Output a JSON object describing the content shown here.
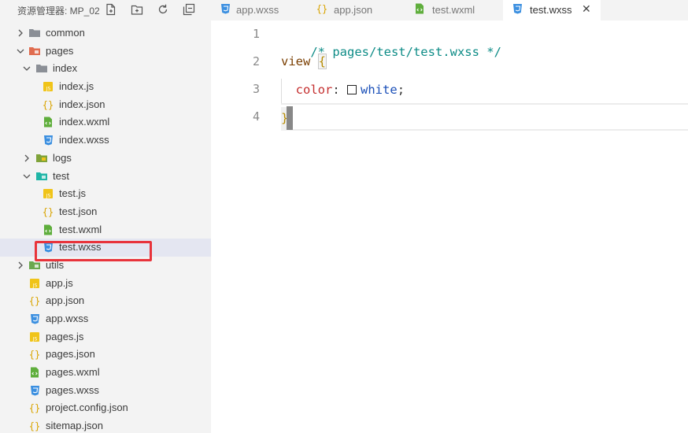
{
  "sidebar": {
    "title": "资源管理器: MP_02",
    "actions": [
      {
        "name": "new-file-icon"
      },
      {
        "name": "new-folder-icon"
      },
      {
        "name": "refresh-icon"
      },
      {
        "name": "collapse-all-icon"
      }
    ],
    "tree": [
      {
        "label": "common",
        "type": "folder",
        "depth": 0,
        "expanded": false,
        "icon": "folder-icon"
      },
      {
        "label": "pages",
        "type": "folder",
        "depth": 0,
        "expanded": true,
        "icon": "pages-folder-icon"
      },
      {
        "label": "index",
        "type": "folder",
        "depth": 1,
        "expanded": true,
        "icon": "folder-icon"
      },
      {
        "label": "index.js",
        "type": "file",
        "depth": 2,
        "icon": "js-file-icon"
      },
      {
        "label": "index.json",
        "type": "file",
        "depth": 2,
        "icon": "json-file-icon"
      },
      {
        "label": "index.wxml",
        "type": "file",
        "depth": 2,
        "icon": "wxml-file-icon"
      },
      {
        "label": "index.wxss",
        "type": "file",
        "depth": 2,
        "icon": "wxss-file-icon"
      },
      {
        "label": "logs",
        "type": "folder",
        "depth": 1,
        "expanded": false,
        "icon": "folder-icon"
      },
      {
        "label": "test",
        "type": "folder",
        "depth": 1,
        "expanded": true,
        "icon": "test-folder-icon"
      },
      {
        "label": "test.js",
        "type": "file",
        "depth": 2,
        "icon": "js-file-icon"
      },
      {
        "label": "test.json",
        "type": "file",
        "depth": 2,
        "icon": "json-file-icon"
      },
      {
        "label": "test.wxml",
        "type": "file",
        "depth": 2,
        "icon": "wxml-file-icon"
      },
      {
        "label": "test.wxss",
        "type": "file",
        "depth": 2,
        "icon": "wxss-file-icon",
        "selected": true
      },
      {
        "label": "utils",
        "type": "folder",
        "depth": 0,
        "expanded": false,
        "icon": "utils-folder-icon"
      },
      {
        "label": "app.js",
        "type": "file",
        "depth": 0,
        "icon": "js-file-icon"
      },
      {
        "label": "app.json",
        "type": "file",
        "depth": 0,
        "icon": "json-file-icon"
      },
      {
        "label": "app.wxss",
        "type": "file",
        "depth": 0,
        "icon": "wxss-file-icon"
      },
      {
        "label": "pages.js",
        "type": "file",
        "depth": 0,
        "icon": "js-file-icon"
      },
      {
        "label": "pages.json",
        "type": "file",
        "depth": 0,
        "icon": "json-file-icon"
      },
      {
        "label": "pages.wxml",
        "type": "file",
        "depth": 0,
        "icon": "wxml-file-icon"
      },
      {
        "label": "pages.wxss",
        "type": "file",
        "depth": 0,
        "icon": "wxss-file-icon"
      },
      {
        "label": "project.config.json",
        "type": "file",
        "depth": 0,
        "icon": "json-file-icon"
      },
      {
        "label": "sitemap.json",
        "type": "file",
        "depth": 0,
        "icon": "json-file-icon"
      }
    ]
  },
  "tabs": [
    {
      "label": "app.wxss",
      "icon": "wxss-file-icon",
      "active": false
    },
    {
      "label": "app.json",
      "icon": "json-file-icon",
      "active": false
    },
    {
      "label": "test.wxml",
      "icon": "wxml-file-icon",
      "active": false
    },
    {
      "label": "test.wxss",
      "icon": "wxss-file-icon",
      "active": true,
      "close": "✕"
    }
  ],
  "editor": {
    "line_numbers": [
      "1",
      "2",
      "3",
      "4"
    ],
    "line1": {
      "comment": "/* pages/test/test.wxss */"
    },
    "line2": {
      "selector": "view ",
      "brace_open": "{"
    },
    "line3": {
      "indent": "  ",
      "property": "color",
      "colon": ": ",
      "value": "white",
      "semi": ";"
    },
    "line4": {
      "brace_close": "}"
    }
  },
  "colors": {
    "sidebar_bg": "#f3f3f3",
    "selected_row": "#e4e6f1",
    "highlight_box": "#e8333b",
    "comment": "#0e8c87",
    "property": "#c42e2e",
    "value": "#1a4fb8"
  }
}
